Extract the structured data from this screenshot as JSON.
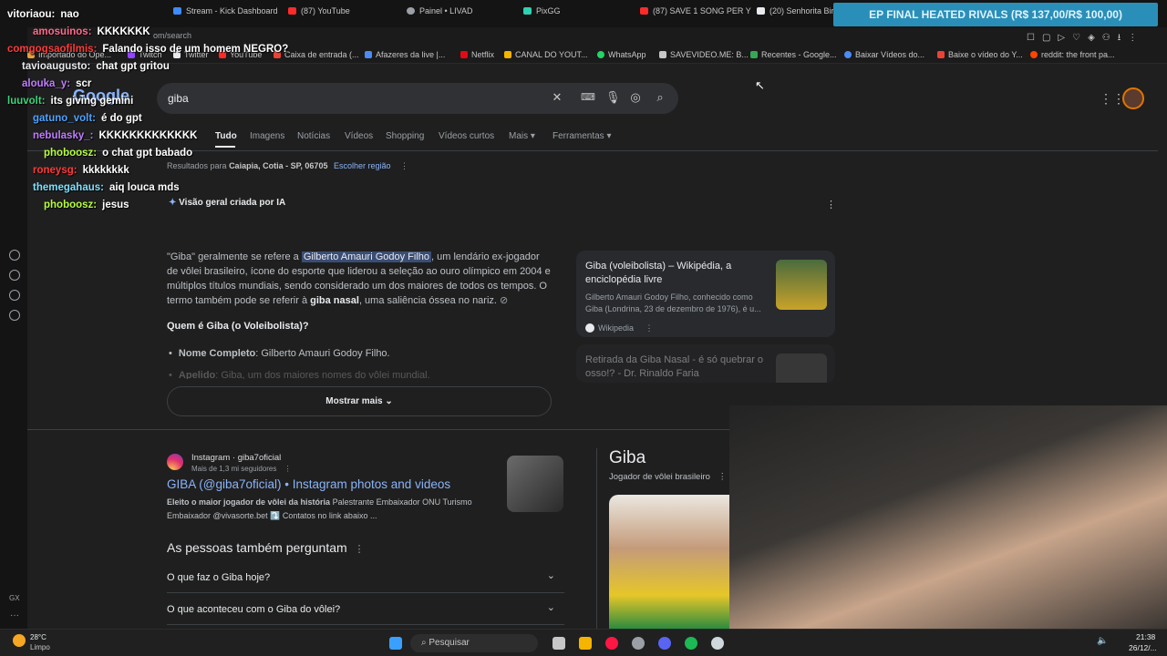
{
  "browser": {
    "tabs": [
      "Stream - Kick Dashboard",
      "(87) YouTube",
      "Painel • LIVAD",
      "PixGG",
      "(87) SAVE 1 SONG PER Y",
      "(20) Senhorita Bira"
    ],
    "tab_colors": [
      "#3c8bff",
      "#ff2b2b",
      "#9aa0a6",
      "#2fd2b0",
      "#ff2b2b",
      "#e8eaed"
    ],
    "url_fragment": "om/search",
    "bookmarks": [
      "Importado do Ope...",
      "Twitch",
      "Twitter",
      "YouTube",
      "Caixa de entrada (...",
      "Afazeres da live |...",
      "Netflix",
      "CANAL DO YOUT...",
      "WhatsApp",
      "SAVEVIDEO.ME: B...",
      "Recentes - Google...",
      "Baixar Vídeos do...",
      "Baixe o vídeo do Y...",
      "reddit: the front pa..."
    ]
  },
  "banner": {
    "text": "EP FINAL HEATED RIVALS (R$ 137,00/R$ 100,00)"
  },
  "google": {
    "logo": "Google",
    "query": "giba",
    "nav": [
      "Tudo",
      "Imagens",
      "Notícias",
      "Vídeos",
      "Shopping",
      "Vídeos curtos",
      "Mais",
      "Ferramentas"
    ],
    "location_prefix": "Resultados para",
    "location": "Caiapia, Cotia - SP, 06705",
    "location_link": "Escolher região",
    "ai_title": "Visão geral criada por IA",
    "ai_p1a": "\"Giba\" geralmente se refere a",
    "ai_p1_hl": "Gilberto Amauri Godoy Filho",
    "ai_p1b": ", um lendário ex-jogador de vôlei brasileiro, ícone do esporte que liderou a seleção ao ouro olímpico em 2004 e múltiplos títulos mundiais, sendo considerado um dos maiores de todos os tempos. O termo também pode se referir à",
    "ai_p1_bold": "giba nasal",
    "ai_p1c": ", uma saliência óssea no nariz.",
    "ai_h": "Quem é Giba (o Voleibolista)?",
    "ai_li1_b": "Nome Completo",
    "ai_li1": ": Gilberto Amauri Godoy Filho.",
    "ai_li2_b": "Apelido",
    "ai_li2": ": Giba, um dos maiores nomes do vôlei mundial.",
    "more": "Mostrar mais",
    "src1_title": "Giba (voleibolista) – Wikipédia, a enciclopédia livre",
    "src1_desc": "Gilberto Amauri Godoy Filho, conhecido como Giba (Londrina, 23 de dezembro de 1976), é u...",
    "src1_site": "Wikipedia",
    "src2_title": "Retirada da Giba Nasal - é só quebrar o osso!? - Dr. Rinaldo Faria",
    "ig_site": "Instagram",
    "ig_handle": "giba7oficial",
    "ig_followers": "Mais de 1,3 mi seguidores",
    "ig_title": "GIBA (@giba7oficial) • Instagram photos and videos",
    "ig_desc_b": "Eleito o maior jogador de vôlei da história",
    "ig_desc": "Palestrante Embaixador ONU Turismo Embaixador @vivasorte.bet ⤵️ Contatos no link abaixo ...",
    "paa_title": "As pessoas também perguntam",
    "paa": [
      "O que faz o Giba hoje?",
      "O que aconteceu com o Giba do vôlei?"
    ],
    "kp_title": "Giba",
    "kp_sub": "Jogador de vôlei brasileiro"
  },
  "chat": [
    {
      "user": "vitoriaou:",
      "msg": "nao",
      "color": "#ffffff"
    },
    {
      "user": "amosuinos:",
      "msg": "KKKKKKK",
      "color": "#ff6b8f"
    },
    {
      "user": "comgogsaofilmis:",
      "msg": "Falando isso de um homem NEGRO?",
      "color": "#ff3b3b"
    },
    {
      "user": "tavioaugusto:",
      "msg": "chat gpt gritou",
      "color": "#e8eaed"
    },
    {
      "user": "alouka_y:",
      "msg": "scr",
      "color": "#c07cff"
    },
    {
      "user": "luuvolt:",
      "msg": "its giving gemini",
      "color": "#3fd37a"
    },
    {
      "user": "gatuno_volt:",
      "msg": "é do gpt",
      "color": "#4fa3ff"
    },
    {
      "user": "nebulasky_:",
      "msg": "KKKKKKKKKKKKK",
      "color": "#c07cff"
    },
    {
      "user": "phoboosz:",
      "msg": "o chat gpt babado",
      "color": "#b7ff3f"
    },
    {
      "user": "roneysg:",
      "msg": "kkkkkkkk",
      "color": "#ff3b3b"
    },
    {
      "user": "themegahaus:",
      "msg": "aiq louca mds",
      "color": "#7fe0ff"
    },
    {
      "user": "phoboosz:",
      "msg": "jesus",
      "color": "#b7ff3f"
    }
  ],
  "taskbar": {
    "temp": "28°C",
    "weather": "Limpo",
    "search": "Pesquisar",
    "time": "21:38",
    "date": "26/12/..."
  }
}
